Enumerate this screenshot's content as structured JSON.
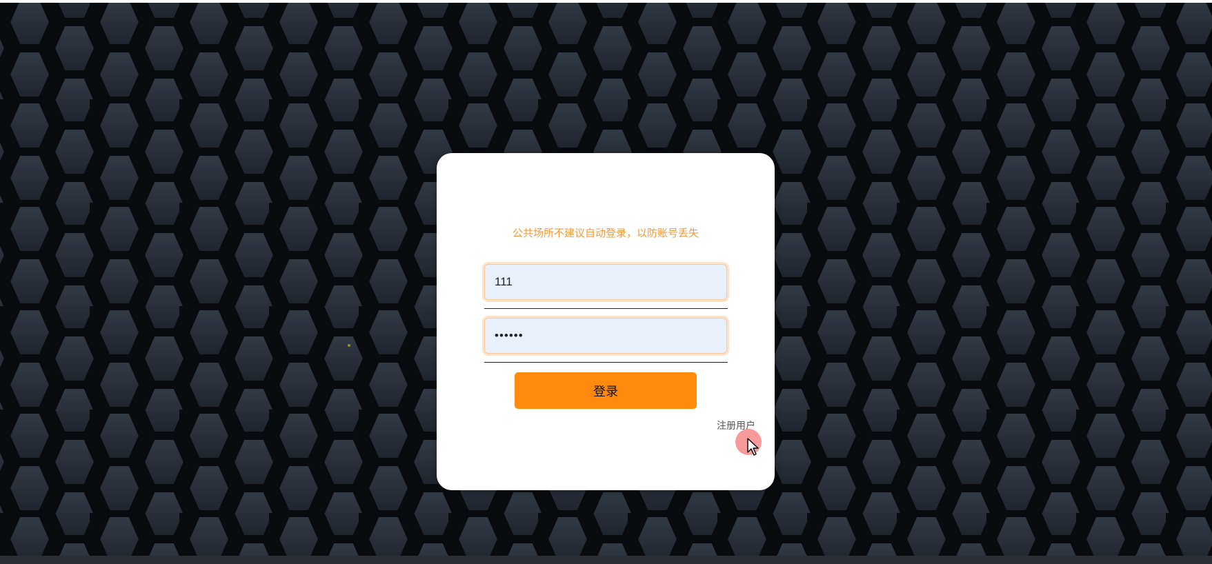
{
  "login": {
    "warning_text": "公共场所不建议自动登录，以防账号丢失",
    "username_value": "111",
    "password_value": "••••••",
    "login_button_label": "登录",
    "register_link_label": "注册用户"
  },
  "colors": {
    "accent": "#ff8a0d",
    "warning": "#f39a3b",
    "input_bg": "#e8f0fc",
    "background": "#1f252e",
    "hex_fill": "#2a323d"
  },
  "icons": {
    "cursor": "arrow-cursor-icon"
  }
}
